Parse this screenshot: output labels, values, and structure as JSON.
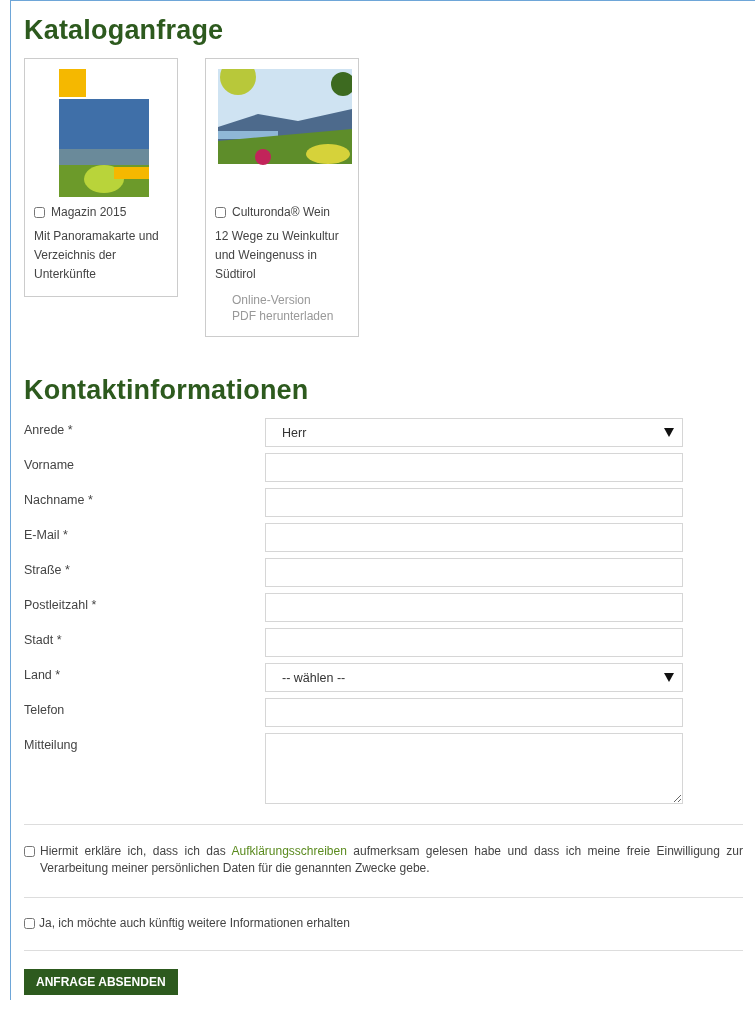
{
  "catalog": {
    "title": "Kataloganfrage",
    "items": [
      {
        "kind": "magazine",
        "name": "Magazin 2015",
        "checked": false,
        "description": "Mit Panoramakarte und Verzeichnis der Unterkünfte"
      },
      {
        "kind": "landscape",
        "name": "Culturonda® Wein",
        "checked": false,
        "description": "12 Wege zu Weinkultur und Weingenuss in Südtirol",
        "links": [
          "Online-Version",
          "PDF herunterladen"
        ]
      }
    ]
  },
  "contact": {
    "title": "Kontaktinformationen",
    "fields": [
      {
        "kind": "select",
        "label": "Anrede *",
        "value": "Herr"
      },
      {
        "kind": "text",
        "label": "Vorname"
      },
      {
        "kind": "text",
        "label": "Nachname *"
      },
      {
        "kind": "text",
        "label": "E-Mail *"
      },
      {
        "kind": "text",
        "label": "Straße *"
      },
      {
        "kind": "text",
        "label": "Postleitzahl *"
      },
      {
        "kind": "text",
        "label": "Stadt *"
      },
      {
        "kind": "select",
        "label": "Land *",
        "value": "-- wählen --"
      },
      {
        "kind": "text",
        "label": "Telefon"
      },
      {
        "kind": "textarea",
        "label": "Mitteilung"
      }
    ]
  },
  "consent": {
    "checked": false,
    "text_before": "Hiermit erkläre ich, dass ich das",
    "link": "Aufklärungsschreiben",
    "text_after": "aufmerksam gelesen habe und dass ich meine freie Einwilligung zur Verarbeitung meiner persönlichen Daten für die genannten Zwecke gebe."
  },
  "newsletter": {
    "checked": false,
    "label": "Ja, ich möchte auch künftig weitere Informationen erhalten"
  },
  "submit": "ANFRAGE ABSENDEN"
}
